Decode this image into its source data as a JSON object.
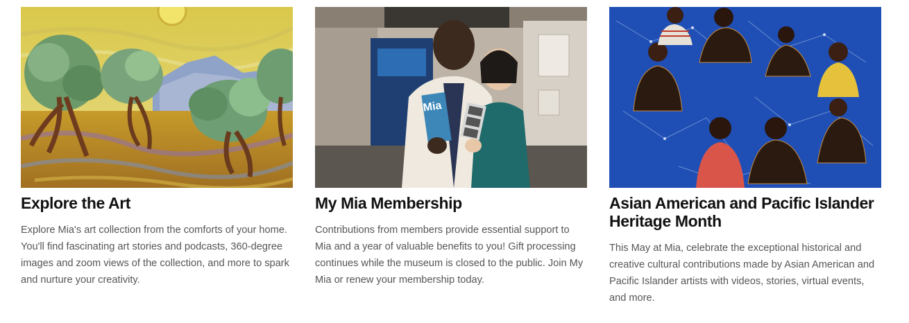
{
  "cards": [
    {
      "title": "Explore the Art",
      "description": "Explore Mia's art collection from the comforts of your home. You'll find fascinating art stories and podcasts, 360-degree images and zoom views of the collection, and more to spark and nurture your creativity.",
      "image_alt": "Painting of olive trees under a yellow sky"
    },
    {
      "title": "My Mia Membership",
      "description": "Contributions from members provide essential support to Mia and a year of valuable benefits to you!  Gift processing continues while the museum is closed to the public.  Join My Mia or renew your membership today.",
      "image_alt": "Smiling couple holding Mia brochure and photo strip",
      "image_text": "Mia"
    },
    {
      "title": "Asian American and Pacific Islander Heritage Month",
      "description": "This May at Mia, celebrate the exceptional historical and creative cultural contributions made by Asian American and Pacific Islander artists with videos, stories, virtual events, and more.",
      "image_alt": "Painting of children seated on a blue constellation map"
    }
  ],
  "colors": {
    "title": "#111111",
    "body_text": "#555555",
    "background": "#ffffff"
  }
}
